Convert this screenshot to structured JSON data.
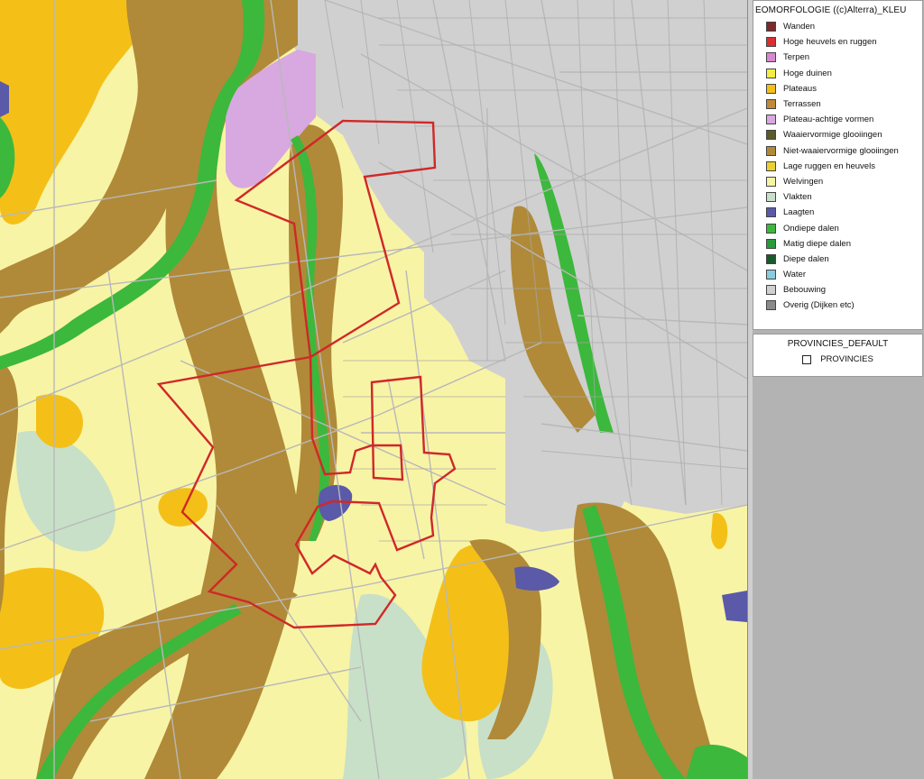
{
  "legend": {
    "title": "EOMORFOLOGIE ((c)Alterra)_KLEU",
    "items": [
      {
        "label": "Wanden",
        "color": "#7a2a2a"
      },
      {
        "label": "Hoge heuvels en ruggen",
        "color": "#d83030"
      },
      {
        "label": "Terpen",
        "color": "#d888d0"
      },
      {
        "label": "Hoge duinen",
        "color": "#f2ee44"
      },
      {
        "label": "Plateaus",
        "color": "#f4c018"
      },
      {
        "label": "Terrassen",
        "color": "#c08a3a"
      },
      {
        "label": "Plateau-achtige vormen",
        "color": "#d8a8e0"
      },
      {
        "label": "Waaiervormige glooiingen",
        "color": "#5a5a2a"
      },
      {
        "label": "Niet-waaiervormige glooiingen",
        "color": "#b08a38"
      },
      {
        "label": "Lage ruggen en heuvels",
        "color": "#ecd030"
      },
      {
        "label": "Welvingen",
        "color": "#f8f4a6"
      },
      {
        "label": "Vlakten",
        "color": "#c8e0c8"
      },
      {
        "label": "Laagten",
        "color": "#5a5aa8"
      },
      {
        "label": "Ondiepe dalen",
        "color": "#3cb83c"
      },
      {
        "label": "Matig diepe dalen",
        "color": "#2a9a3a"
      },
      {
        "label": "Diepe dalen",
        "color": "#1a5a2a"
      },
      {
        "label": "Water",
        "color": "#88ccdd"
      },
      {
        "label": "Bebouwing",
        "color": "#d0d0d0"
      },
      {
        "label": "Overig (Dijken etc)",
        "color": "#8a8a8a"
      }
    ]
  },
  "layer2": {
    "title": "PROVINCIES_DEFAULT",
    "item_label": "PROVINCIES"
  },
  "map": {
    "boundary_color": "#d02828"
  }
}
